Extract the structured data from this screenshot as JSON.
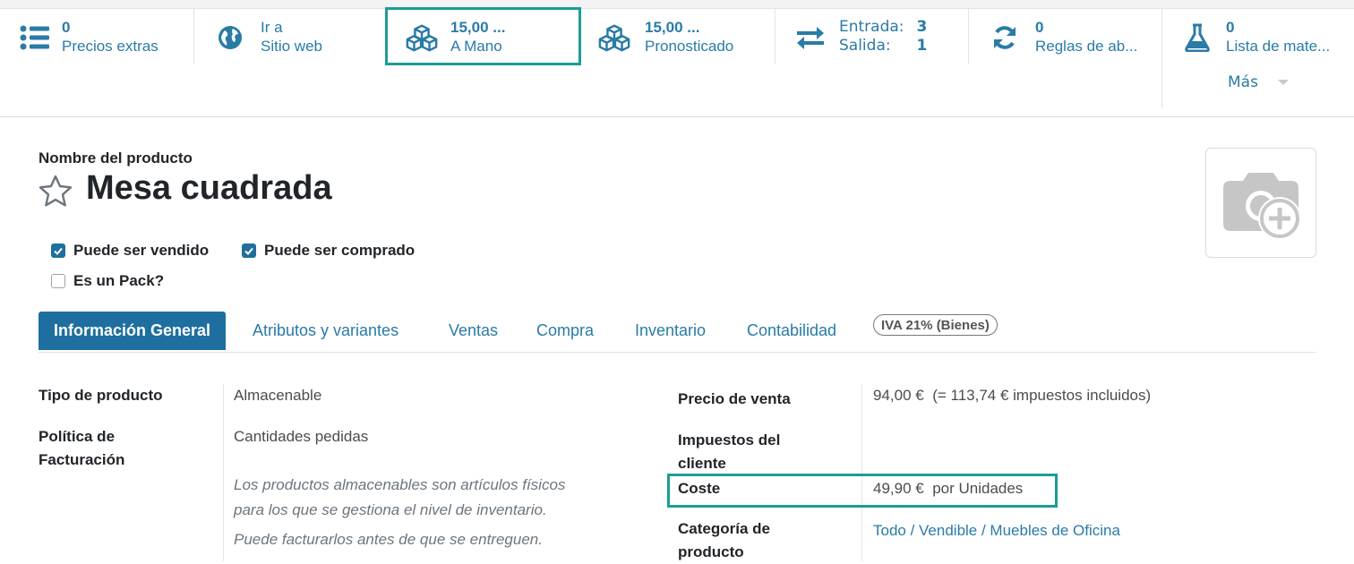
{
  "smart_buttons": {
    "extra_prices": {
      "value": "0",
      "label": "Precios extras",
      "icon": "list-icon"
    },
    "website": {
      "line1": "Ir a",
      "line2": "Sitio web",
      "icon": "globe-icon"
    },
    "on_hand": {
      "value": "15,00 ...",
      "label": "A Mano",
      "icon": "cubes-icon"
    },
    "forecasted": {
      "value": "15,00 ...",
      "label": "Pronosticado",
      "icon": "cubes-icon"
    },
    "in_out": {
      "in_label": "Entrada:",
      "in_value": "3",
      "out_label": "Salida:",
      "out_value": "1",
      "icon": "exchange-icon"
    },
    "reorder_rules": {
      "value": "0",
      "label": "Reglas de ab...",
      "icon": "refresh-icon"
    },
    "bom": {
      "value": "0",
      "label": "Lista de mate...",
      "icon": "flask-icon"
    },
    "more": "Más"
  },
  "product": {
    "name_label": "Nombre del producto",
    "name": "Mesa cuadrada",
    "can_be_sold": "Puede ser vendido",
    "can_be_purchased": "Puede ser comprado",
    "is_pack": "Es un Pack?"
  },
  "tabs": [
    "Información General",
    "Atributos y variantes",
    "Ventas",
    "Compra",
    "Inventario",
    "Contabilidad"
  ],
  "left_fields": {
    "product_type_label": "Tipo de producto",
    "product_type_value": "Almacenable",
    "invoice_policy_label_1": "Política de",
    "invoice_policy_label_2": "Facturación",
    "invoice_policy_value": "Cantidades pedidas",
    "note_1a": "Los productos almacenables son artículos físicos",
    "note_1b": "para los que se gestiona el nivel de inventario.",
    "note_2": "Puede facturarlos antes de que se entreguen."
  },
  "right_fields": {
    "sale_price_label": "Precio de venta",
    "sale_price_value": "94,00 €",
    "sale_price_tax": "(= 113,74 € impuestos incluidos)",
    "customer_taxes_label_1": "Impuestos del",
    "customer_taxes_label_2": "cliente",
    "customer_taxes_badge": "IVA 21% (Bienes)",
    "cost_label": "Coste",
    "cost_value": "49,90 €",
    "cost_uom": "por Unidades",
    "category_label_1": "Categoría de",
    "category_label_2": "producto",
    "category_value": "Todo / Vendible / Muebles de Oficina"
  },
  "colors": {
    "accent": "#2a7ba6",
    "active_tab": "#1e6fa0",
    "highlight": "#1c9c96"
  }
}
